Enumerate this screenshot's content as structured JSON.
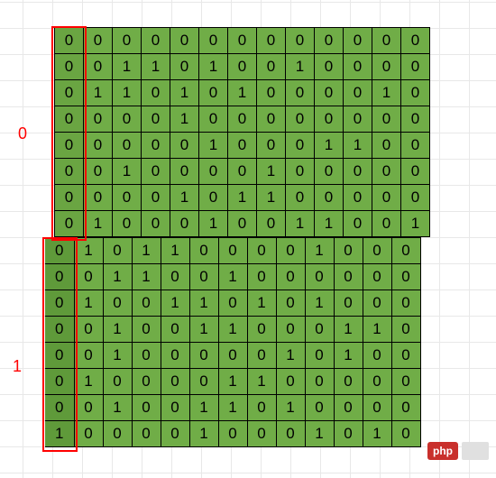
{
  "chart_data": {
    "type": "table",
    "title": "Binary Matrix Grid",
    "groups": [
      {
        "label": "0",
        "rows": [
          [
            0,
            0,
            0,
            0,
            0,
            0,
            0,
            0,
            0,
            0,
            0,
            0,
            0
          ],
          [
            0,
            0,
            1,
            1,
            0,
            1,
            0,
            0,
            1,
            0,
            0,
            0,
            0
          ],
          [
            0,
            1,
            1,
            0,
            1,
            0,
            1,
            0,
            0,
            0,
            0,
            1,
            0
          ],
          [
            0,
            0,
            0,
            0,
            1,
            0,
            0,
            0,
            0,
            0,
            0,
            0,
            0
          ],
          [
            0,
            0,
            0,
            0,
            0,
            1,
            0,
            0,
            0,
            1,
            1,
            0,
            0
          ],
          [
            0,
            0,
            1,
            0,
            0,
            0,
            0,
            1,
            0,
            0,
            0,
            0,
            0
          ],
          [
            0,
            0,
            0,
            0,
            1,
            0,
            1,
            1,
            0,
            0,
            0,
            0,
            0
          ],
          [
            0,
            1,
            0,
            0,
            0,
            1,
            0,
            0,
            1,
            1,
            0,
            0,
            1
          ]
        ]
      },
      {
        "label": "1",
        "rows": [
          [
            0,
            1,
            0,
            1,
            1,
            0,
            0,
            0,
            0,
            1,
            0,
            0,
            0
          ],
          [
            0,
            0,
            1,
            1,
            0,
            0,
            1,
            0,
            0,
            0,
            0,
            0,
            0
          ],
          [
            0,
            1,
            0,
            0,
            1,
            1,
            0,
            1,
            0,
            1,
            0,
            0,
            0
          ],
          [
            0,
            0,
            1,
            0,
            0,
            1,
            1,
            0,
            0,
            0,
            1,
            1,
            0
          ],
          [
            0,
            0,
            1,
            0,
            0,
            0,
            0,
            0,
            1,
            0,
            1,
            0,
            0
          ],
          [
            0,
            1,
            0,
            0,
            0,
            0,
            1,
            1,
            0,
            0,
            0,
            0,
            0
          ],
          [
            0,
            0,
            1,
            0,
            0,
            1,
            1,
            0,
            1,
            0,
            0,
            0,
            0
          ],
          [
            1,
            0,
            0,
            0,
            0,
            1,
            0,
            0,
            0,
            1,
            0,
            1,
            0
          ]
        ]
      }
    ]
  },
  "watermark": {
    "text": "php"
  }
}
